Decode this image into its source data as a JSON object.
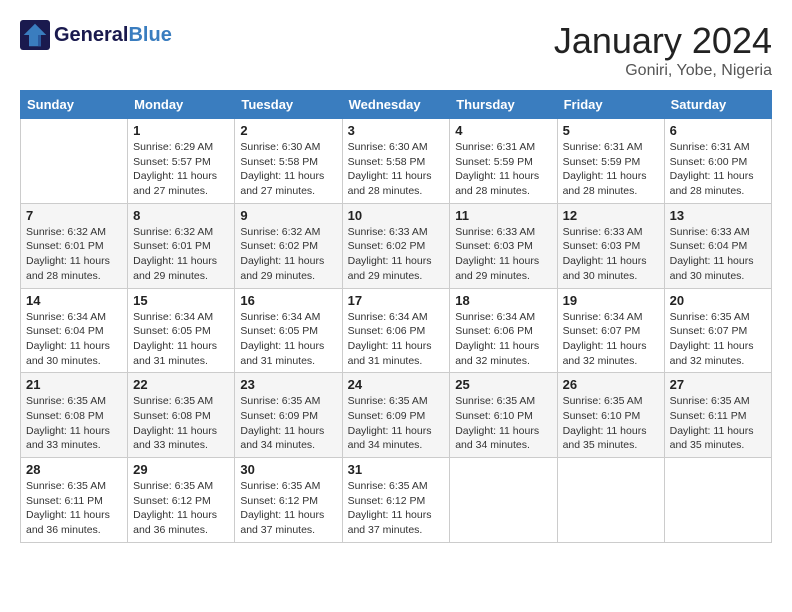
{
  "header": {
    "logo_line1": "General",
    "logo_line2": "Blue",
    "month": "January 2024",
    "location": "Goniri, Yobe, Nigeria"
  },
  "days_of_week": [
    "Sunday",
    "Monday",
    "Tuesday",
    "Wednesday",
    "Thursday",
    "Friday",
    "Saturday"
  ],
  "weeks": [
    [
      {
        "day": "",
        "sunrise": "",
        "sunset": "",
        "daylight": ""
      },
      {
        "day": "1",
        "sunrise": "Sunrise: 6:29 AM",
        "sunset": "Sunset: 5:57 PM",
        "daylight": "Daylight: 11 hours and 27 minutes."
      },
      {
        "day": "2",
        "sunrise": "Sunrise: 6:30 AM",
        "sunset": "Sunset: 5:58 PM",
        "daylight": "Daylight: 11 hours and 27 minutes."
      },
      {
        "day": "3",
        "sunrise": "Sunrise: 6:30 AM",
        "sunset": "Sunset: 5:58 PM",
        "daylight": "Daylight: 11 hours and 28 minutes."
      },
      {
        "day": "4",
        "sunrise": "Sunrise: 6:31 AM",
        "sunset": "Sunset: 5:59 PM",
        "daylight": "Daylight: 11 hours and 28 minutes."
      },
      {
        "day": "5",
        "sunrise": "Sunrise: 6:31 AM",
        "sunset": "Sunset: 5:59 PM",
        "daylight": "Daylight: 11 hours and 28 minutes."
      },
      {
        "day": "6",
        "sunrise": "Sunrise: 6:31 AM",
        "sunset": "Sunset: 6:00 PM",
        "daylight": "Daylight: 11 hours and 28 minutes."
      }
    ],
    [
      {
        "day": "7",
        "sunrise": "Sunrise: 6:32 AM",
        "sunset": "Sunset: 6:01 PM",
        "daylight": "Daylight: 11 hours and 28 minutes."
      },
      {
        "day": "8",
        "sunrise": "Sunrise: 6:32 AM",
        "sunset": "Sunset: 6:01 PM",
        "daylight": "Daylight: 11 hours and 29 minutes."
      },
      {
        "day": "9",
        "sunrise": "Sunrise: 6:32 AM",
        "sunset": "Sunset: 6:02 PM",
        "daylight": "Daylight: 11 hours and 29 minutes."
      },
      {
        "day": "10",
        "sunrise": "Sunrise: 6:33 AM",
        "sunset": "Sunset: 6:02 PM",
        "daylight": "Daylight: 11 hours and 29 minutes."
      },
      {
        "day": "11",
        "sunrise": "Sunrise: 6:33 AM",
        "sunset": "Sunset: 6:03 PM",
        "daylight": "Daylight: 11 hours and 29 minutes."
      },
      {
        "day": "12",
        "sunrise": "Sunrise: 6:33 AM",
        "sunset": "Sunset: 6:03 PM",
        "daylight": "Daylight: 11 hours and 30 minutes."
      },
      {
        "day": "13",
        "sunrise": "Sunrise: 6:33 AM",
        "sunset": "Sunset: 6:04 PM",
        "daylight": "Daylight: 11 hours and 30 minutes."
      }
    ],
    [
      {
        "day": "14",
        "sunrise": "Sunrise: 6:34 AM",
        "sunset": "Sunset: 6:04 PM",
        "daylight": "Daylight: 11 hours and 30 minutes."
      },
      {
        "day": "15",
        "sunrise": "Sunrise: 6:34 AM",
        "sunset": "Sunset: 6:05 PM",
        "daylight": "Daylight: 11 hours and 31 minutes."
      },
      {
        "day": "16",
        "sunrise": "Sunrise: 6:34 AM",
        "sunset": "Sunset: 6:05 PM",
        "daylight": "Daylight: 11 hours and 31 minutes."
      },
      {
        "day": "17",
        "sunrise": "Sunrise: 6:34 AM",
        "sunset": "Sunset: 6:06 PM",
        "daylight": "Daylight: 11 hours and 31 minutes."
      },
      {
        "day": "18",
        "sunrise": "Sunrise: 6:34 AM",
        "sunset": "Sunset: 6:06 PM",
        "daylight": "Daylight: 11 hours and 32 minutes."
      },
      {
        "day": "19",
        "sunrise": "Sunrise: 6:34 AM",
        "sunset": "Sunset: 6:07 PM",
        "daylight": "Daylight: 11 hours and 32 minutes."
      },
      {
        "day": "20",
        "sunrise": "Sunrise: 6:35 AM",
        "sunset": "Sunset: 6:07 PM",
        "daylight": "Daylight: 11 hours and 32 minutes."
      }
    ],
    [
      {
        "day": "21",
        "sunrise": "Sunrise: 6:35 AM",
        "sunset": "Sunset: 6:08 PM",
        "daylight": "Daylight: 11 hours and 33 minutes."
      },
      {
        "day": "22",
        "sunrise": "Sunrise: 6:35 AM",
        "sunset": "Sunset: 6:08 PM",
        "daylight": "Daylight: 11 hours and 33 minutes."
      },
      {
        "day": "23",
        "sunrise": "Sunrise: 6:35 AM",
        "sunset": "Sunset: 6:09 PM",
        "daylight": "Daylight: 11 hours and 34 minutes."
      },
      {
        "day": "24",
        "sunrise": "Sunrise: 6:35 AM",
        "sunset": "Sunset: 6:09 PM",
        "daylight": "Daylight: 11 hours and 34 minutes."
      },
      {
        "day": "25",
        "sunrise": "Sunrise: 6:35 AM",
        "sunset": "Sunset: 6:10 PM",
        "daylight": "Daylight: 11 hours and 34 minutes."
      },
      {
        "day": "26",
        "sunrise": "Sunrise: 6:35 AM",
        "sunset": "Sunset: 6:10 PM",
        "daylight": "Daylight: 11 hours and 35 minutes."
      },
      {
        "day": "27",
        "sunrise": "Sunrise: 6:35 AM",
        "sunset": "Sunset: 6:11 PM",
        "daylight": "Daylight: 11 hours and 35 minutes."
      }
    ],
    [
      {
        "day": "28",
        "sunrise": "Sunrise: 6:35 AM",
        "sunset": "Sunset: 6:11 PM",
        "daylight": "Daylight: 11 hours and 36 minutes."
      },
      {
        "day": "29",
        "sunrise": "Sunrise: 6:35 AM",
        "sunset": "Sunset: 6:12 PM",
        "daylight": "Daylight: 11 hours and 36 minutes."
      },
      {
        "day": "30",
        "sunrise": "Sunrise: 6:35 AM",
        "sunset": "Sunset: 6:12 PM",
        "daylight": "Daylight: 11 hours and 37 minutes."
      },
      {
        "day": "31",
        "sunrise": "Sunrise: 6:35 AM",
        "sunset": "Sunset: 6:12 PM",
        "daylight": "Daylight: 11 hours and 37 minutes."
      },
      {
        "day": "",
        "sunrise": "",
        "sunset": "",
        "daylight": ""
      },
      {
        "day": "",
        "sunrise": "",
        "sunset": "",
        "daylight": ""
      },
      {
        "day": "",
        "sunrise": "",
        "sunset": "",
        "daylight": ""
      }
    ]
  ]
}
